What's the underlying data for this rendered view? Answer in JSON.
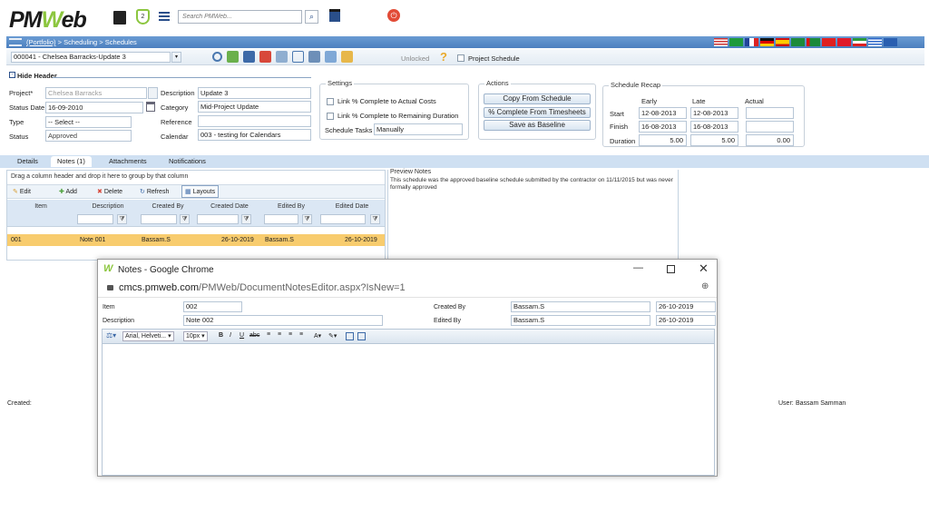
{
  "app": {
    "logo_text": "PMWeb",
    "search_placeholder": "Search PMWeb..."
  },
  "breadcrumb": {
    "portfolio": "(Portfolio)",
    "rest": " > Scheduling > Schedules"
  },
  "record_select": {
    "value": "000041 - Chelsea Barracks-Update 3"
  },
  "toolbar": {
    "unlocked_label": "Unlocked",
    "project_schedule_label": "Project Schedule"
  },
  "header": {
    "hide_label": "Hide Header",
    "project_label": "Project*",
    "project_value": "Chelsea Barracks",
    "status_date_label": "Status Date",
    "status_date_value": "16-09-2010",
    "type_label": "Type",
    "type_value": "-- Select --",
    "status_label": "Status",
    "status_value": "Approved",
    "description_label": "Description",
    "description_value": "Update 3",
    "category_label": "Category",
    "category_value": "Mid-Project Update",
    "reference_label": "Reference",
    "reference_value": "",
    "calendar_label": "Calendar",
    "calendar_value": "003 - testing for Calendars"
  },
  "settings": {
    "title": "Settings",
    "opt1": "Link % Complete to Actual Costs",
    "opt2": "Link % Complete to Remaining Duration",
    "schedule_tasks_label": "Schedule Tasks",
    "schedule_tasks_value": "Manually"
  },
  "actions": {
    "title": "Actions",
    "btn1": "Copy From Schedule",
    "btn2": "% Complete From Timesheets",
    "btn3": "Save as Baseline"
  },
  "recap": {
    "title": "Schedule Recap",
    "col_early": "Early",
    "col_late": "Late",
    "col_actual": "Actual",
    "start_label": "Start",
    "start_early": "12-08-2013",
    "start_late": "12-08-2013",
    "start_actual": "",
    "finish_label": "Finish",
    "finish_early": "16-08-2013",
    "finish_late": "16-08-2013",
    "finish_actual": "",
    "duration_label": "Duration",
    "duration_early": "5.00",
    "duration_late": "5.00",
    "duration_actual": "0.00"
  },
  "tabs": [
    "Details",
    "Notes (1)",
    "Attachments",
    "Notifications"
  ],
  "grid": {
    "group_hint": "Drag a column header and drop it here to group by that column",
    "edit": "Edit",
    "add": "Add",
    "delete": "Delete",
    "refresh": "Refresh",
    "layouts": "Layouts",
    "columns": [
      "Item",
      "Description",
      "Created By",
      "Created Date",
      "Edited By",
      "Edited Date"
    ],
    "row": {
      "item": "001",
      "description": "Note 001",
      "created_by": "Bassam.S",
      "created_date": "26-10-2019",
      "edited_by": "Bassam.S",
      "edited_date": "26-10-2019"
    }
  },
  "preview": {
    "title": "Preview Notes",
    "text": "This schedule was the approved baseline schedule submitted by the contractor on 11/11/2015 but was never formally approved"
  },
  "footer": {
    "created_label": "Created:",
    "user_label": "User:",
    "user_value": "Bassam Samman"
  },
  "popup": {
    "title": "Notes - Google Chrome",
    "url_host": "cmcs.pmweb.com",
    "url_path": "/PMWeb/DocumentNotesEditor.aspx?IsNew=1",
    "item_label": "Item",
    "item_value": "002",
    "description_label": "Description",
    "description_value": "Note 002",
    "created_by_label": "Created By",
    "created_by_value": "Bassam.S",
    "created_date_value": "26-10-2019",
    "edited_by_label": "Edited By",
    "edited_by_value": "Bassam.S",
    "edited_date_value": "26-10-2019",
    "font_family": "Arial, Helveti...",
    "font_size": "10px"
  },
  "colors": {
    "nav_bar": "#5b8ec8",
    "tab_bar": "#cfe0f2",
    "selected_row": "#f8cc6e",
    "brand_green": "#8cc63f"
  }
}
